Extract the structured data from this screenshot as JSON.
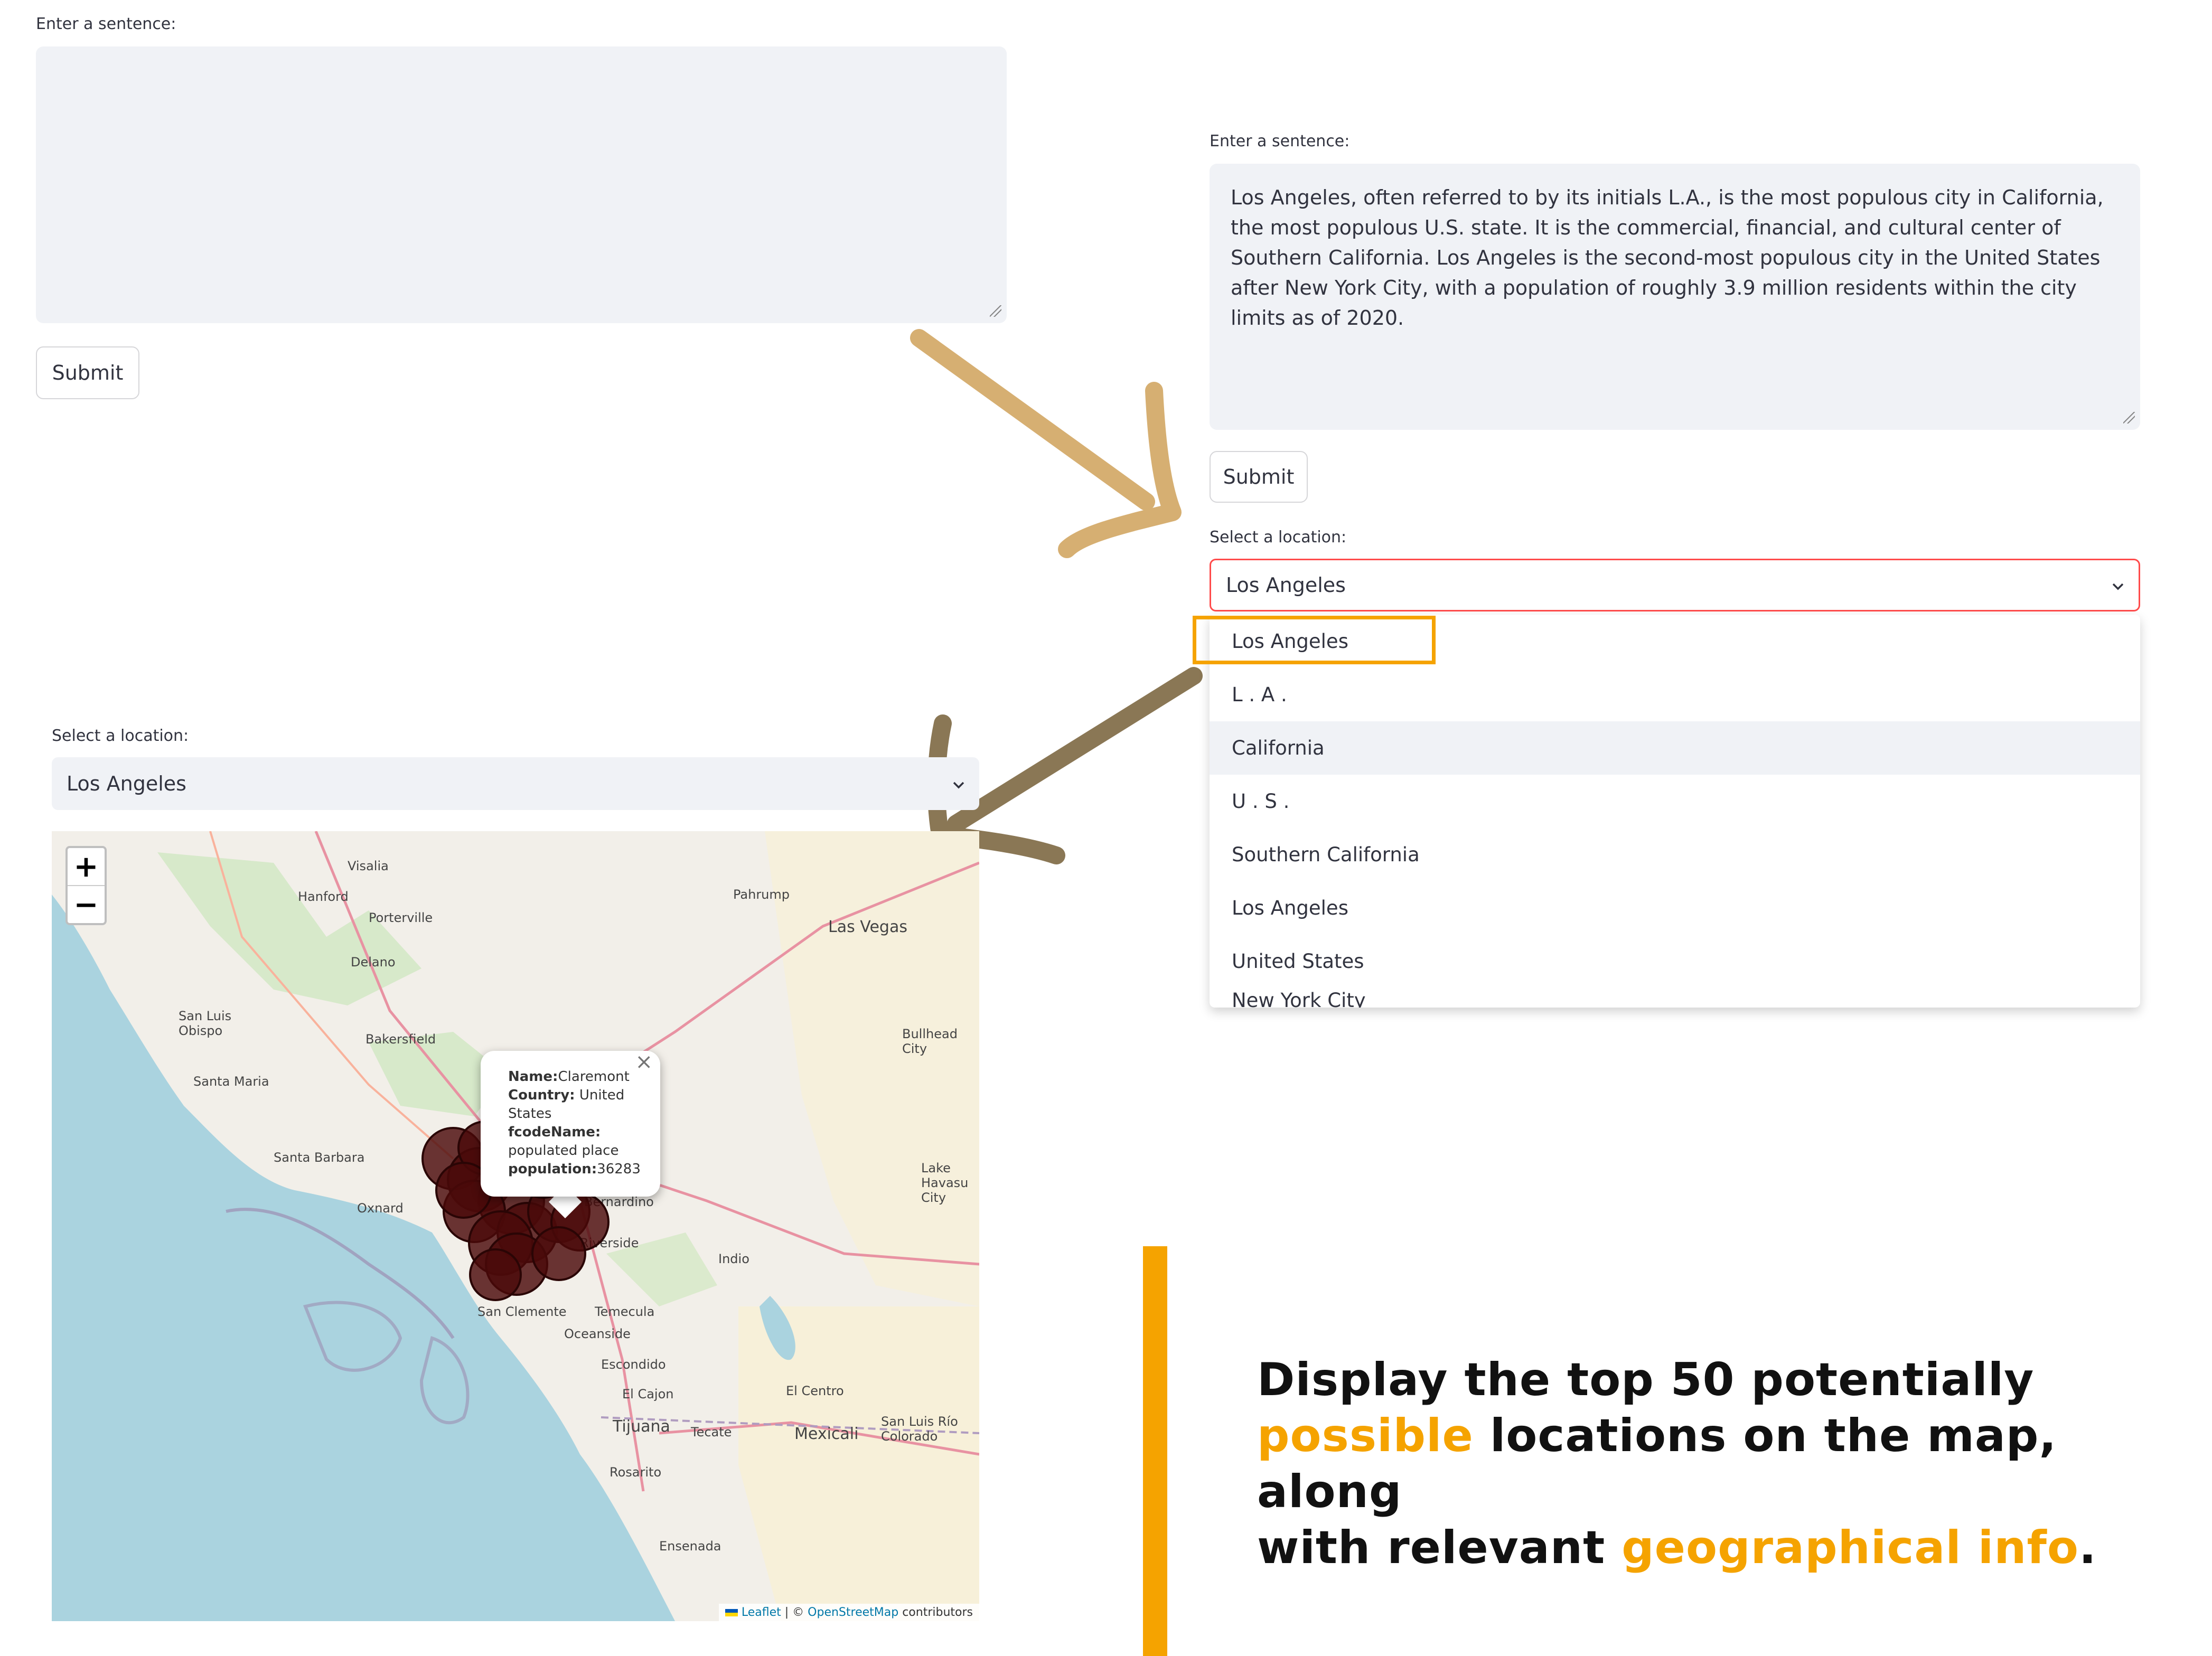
{
  "left_form": {
    "label": "Enter a sentence:",
    "text": "",
    "submit_label": "Submit"
  },
  "right_form": {
    "label": "Enter a sentence:",
    "text": "Los Angeles, often referred to by its initials L.A., is the most populous  city in California, the most populous U.S. state. It is the commercial, financial,  and cultural center of Southern California. Los Angeles is the second-most populous city in the United States after New York City, with a population of roughly 3.9  million residents within the city limits as of 2020.",
    "submit_label": "Submit",
    "select_label": "Select a location:",
    "select_value": "Los Angeles",
    "options": [
      "Los Angeles",
      "L . A .",
      "California",
      "U . S .",
      "Southern California",
      "Los Angeles",
      "United States",
      "New York City"
    ],
    "highlighted_option_index": 2
  },
  "map_panel": {
    "select_label": "Select a location:",
    "select_value": "Los Angeles",
    "zoom_in": "+",
    "zoom_out": "−",
    "popup": {
      "name_label": "Name:",
      "name": "Claremont",
      "country_label": "Country:",
      "country": "United States",
      "fcode_label": "fcodeName:",
      "fcode": "populated place",
      "population_label": "population:",
      "population": "36283",
      "close": "×"
    },
    "places": [
      "Visalia",
      "Hanford",
      "Porterville",
      "Delano",
      "Pahrump",
      "Las Vegas",
      "San Luis Obispo",
      "Bakersfield",
      "Bullhead City",
      "Santa Maria",
      "Santa Barbara",
      "Oxnard",
      "Lake Havasu City",
      "Bernardino",
      "Riverside",
      "Indio",
      "San Clemente",
      "Temecula",
      "Oceanside",
      "Escondido",
      "El Cajon",
      "El Centro",
      "Tijuana",
      "Tecate",
      "Mexicali",
      "San Luis Río Colorado",
      "Rosarito",
      "Ensenada"
    ],
    "attribution_leaflet": "Leaflet",
    "attribution_sep": " | © ",
    "attribution_osm": "OpenStreetMap",
    "attribution_tail": " contributors"
  },
  "caption": {
    "line1": "Display the top 50 potentially",
    "line2_accent": "possible",
    "line2_rest": " locations on the map, along",
    "line3_start": "with relevant ",
    "line3_accent": "geographical info",
    "line3_end": "."
  },
  "colors": {
    "accent_orange": "#f5a300",
    "arrow_tan": "#d6af72",
    "arrow_brown": "#8a7755",
    "marker": "#4a0a0a",
    "select_border_red": "#ff4b4b"
  }
}
